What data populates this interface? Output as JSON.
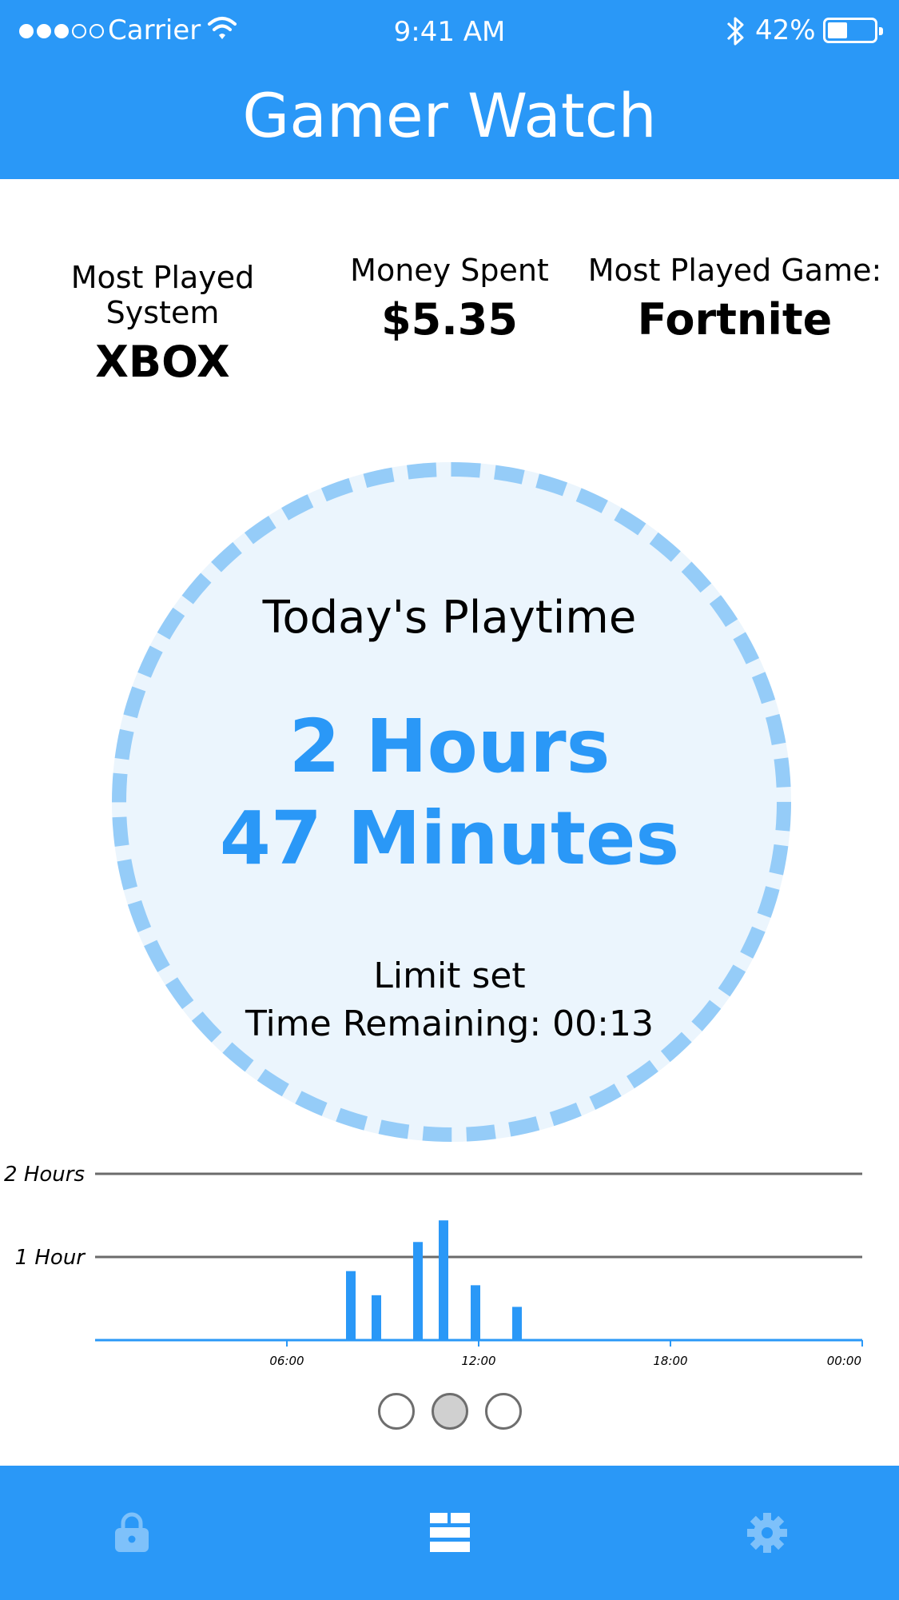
{
  "status_bar": {
    "carrier": "Carrier",
    "time": "9:41 AM",
    "battery_percent": "42%",
    "battery_level": 0.42,
    "signal_bars_filled": 3,
    "signal_bars_total": 5
  },
  "header": {
    "title": "Gamer Watch"
  },
  "stats": {
    "system": {
      "label": "Most Played System",
      "value": "XBOX"
    },
    "money": {
      "label": "Money Spent",
      "value": "$5.35"
    },
    "game": {
      "label": "Most Played Game:",
      "value": "Fortnite"
    }
  },
  "playtime": {
    "title": "Today's Playtime",
    "hours": "2 Hours",
    "minutes": "47 Minutes",
    "limit": "Limit set",
    "remaining": "Time Remaining: 00:13"
  },
  "chart_data": {
    "type": "bar",
    "title": "",
    "xlabel": "",
    "ylabel": "",
    "x_ticks": [
      "06:00",
      "12:00",
      "18:00",
      "00:00"
    ],
    "y_ticks": [
      "1 Hour",
      "2 Hours"
    ],
    "ylim_hours": [
      0,
      2
    ],
    "xlim_hours": [
      0,
      24
    ],
    "bars": [
      {
        "hour": 8.0,
        "value": 0.83
      },
      {
        "hour": 8.8,
        "value": 0.54
      },
      {
        "hour": 10.1,
        "value": 1.18
      },
      {
        "hour": 10.9,
        "value": 1.44
      },
      {
        "hour": 11.9,
        "value": 0.66
      },
      {
        "hour": 13.2,
        "value": 0.4
      }
    ],
    "grid": true,
    "colors": {
      "bar": "#2a98f7",
      "gridline": "#6b6b6b"
    }
  },
  "pager": {
    "count": 3,
    "active": 1
  },
  "tabbar": {
    "tabs": [
      {
        "name": "lock",
        "icon": "lock-icon"
      },
      {
        "name": "dashboard",
        "icon": "dashboard-icon"
      },
      {
        "name": "settings",
        "icon": "gear-icon"
      }
    ],
    "active": 1
  },
  "colors": {
    "primary": "#2a98f7",
    "ring_fill": "#ebf5fd",
    "ring_border": "#95ccf8"
  }
}
